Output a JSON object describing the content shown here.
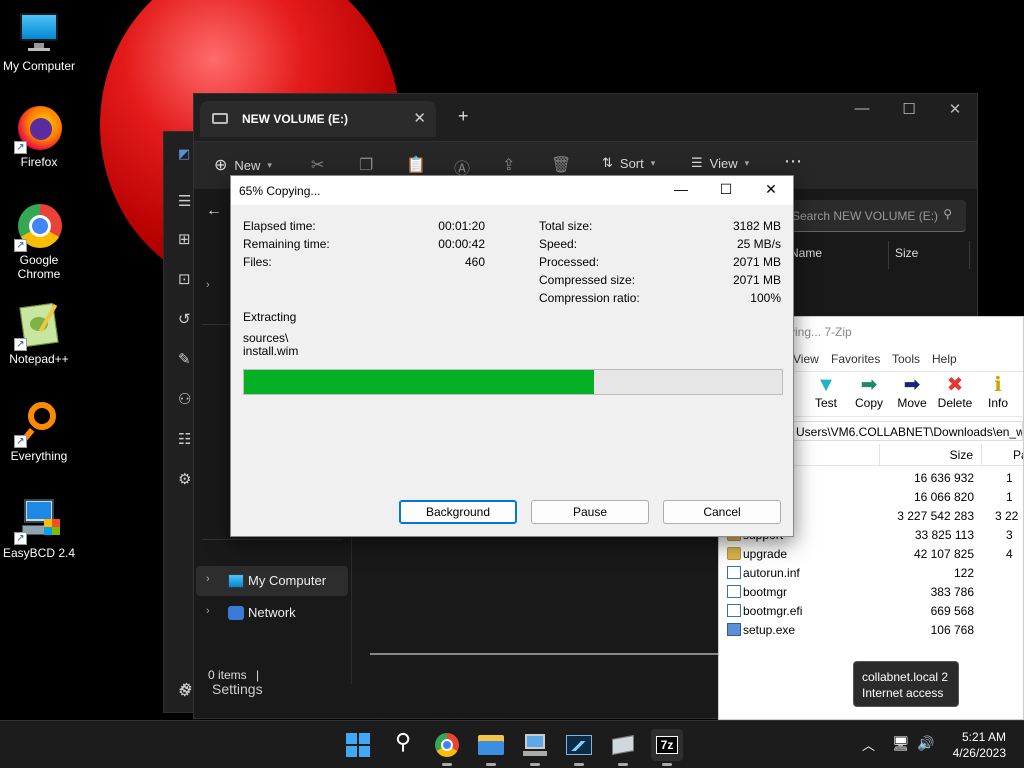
{
  "desktop": {
    "icons": [
      {
        "label": "My Computer",
        "icon": "monitor-icon"
      },
      {
        "label": "Firefox",
        "icon": "firefox-icon"
      },
      {
        "label": "Google Chrome",
        "icon": "chrome-icon"
      },
      {
        "label": "Notepad++",
        "icon": "notepadpp-icon"
      },
      {
        "label": "Everything",
        "icon": "everything-icon"
      },
      {
        "label": "EasyBCD 2.4",
        "icon": "easybcd-icon"
      }
    ]
  },
  "explorer": {
    "tab_title": "NEW VOLUME (E:)",
    "new_label": "New",
    "sort_label": "Sort",
    "view_label": "View",
    "search_placeholder": "Search NEW VOLUME (E:)",
    "column_name": "Name",
    "column_size": "Size",
    "nav": [
      {
        "label": "My Computer"
      },
      {
        "label": "Network"
      }
    ],
    "status": "0 items",
    "settings_label": "Settings"
  },
  "copy_dialog": {
    "title": "65% Copying...",
    "elapsed_label": "Elapsed time:",
    "elapsed_value": "00:01:20",
    "remaining_label": "Remaining time:",
    "remaining_value": "00:00:42",
    "files_label": "Files:",
    "files_value": "460",
    "total_label": "Total size:",
    "total_value": "3182 MB",
    "speed_label": "Speed:",
    "speed_value": "25 MB/s",
    "processed_label": "Processed:",
    "processed_value": "2071 MB",
    "compressed_label": "Compressed size:",
    "compressed_value": "2071 MB",
    "ratio_label": "Compression ratio:",
    "ratio_value": "100%",
    "action": "Extracting",
    "path_line1": "sources\\",
    "path_line2": "install.wim",
    "progress_fraction": 0.65,
    "background_btn": "Background",
    "pause_btn": "Pause",
    "cancel_btn": "Cancel"
  },
  "zip": {
    "title_fragment": "ying... 7-Zip",
    "menu": [
      "View",
      "Favorites",
      "Tools",
      "Help"
    ],
    "toolbar": [
      {
        "label": "t",
        "icon": "extract-icon"
      },
      {
        "label": "Test",
        "icon": "test-icon"
      },
      {
        "label": "Copy",
        "icon": "copy-icon"
      },
      {
        "label": "Move",
        "icon": "move-icon"
      },
      {
        "label": "Delete",
        "icon": "delete-icon"
      },
      {
        "label": "Info",
        "icon": "info-icon"
      }
    ],
    "path": "Users\\VM6.COLLABNET\\Downloads\\en_wind",
    "col_size": "Size",
    "col_packed": "Pa",
    "rows": [
      {
        "name": "",
        "size": "16 636 932",
        "packed": "1",
        "type": "none"
      },
      {
        "name": "",
        "size": "16 066 820",
        "packed": "1",
        "type": "none"
      },
      {
        "name": "",
        "size": "3 227 542 283",
        "packed": "3 22",
        "type": "none"
      },
      {
        "name": "support",
        "size": "33 825 113",
        "packed": "3",
        "type": "folder"
      },
      {
        "name": "upgrade",
        "size": "42 107 825",
        "packed": "4",
        "type": "folder"
      },
      {
        "name": "autorun.inf",
        "size": "122",
        "packed": "",
        "type": "file"
      },
      {
        "name": "bootmgr",
        "size": "383 786",
        "packed": "",
        "type": "file"
      },
      {
        "name": "bootmgr.efi",
        "size": "669 568",
        "packed": "",
        "type": "file"
      },
      {
        "name": "setup.exe",
        "size": "106 768",
        "packed": "",
        "type": "exe"
      }
    ]
  },
  "tooltip": {
    "line1": "collabnet.local 2",
    "line2": "Internet access"
  },
  "taskbar": {
    "apps": [
      "start-icon",
      "search-icon",
      "chrome-icon",
      "file-explorer-icon",
      "network-computer-icon",
      "performance-icon",
      "easybcd-icon",
      "7zip-icon"
    ],
    "zip_label": "7z",
    "time": "5:21 AM",
    "date": "4/26/2023"
  }
}
